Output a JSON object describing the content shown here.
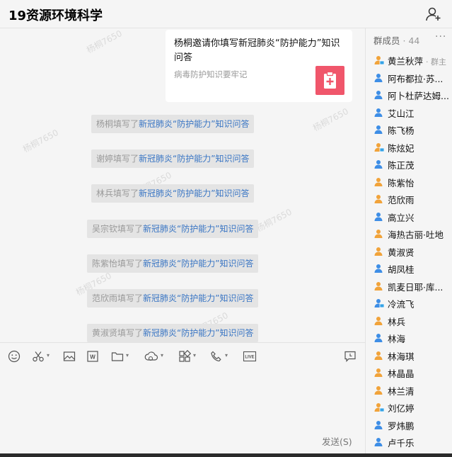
{
  "header": {
    "title": "19资源环境科学",
    "add_member_icon": "add-person-icon"
  },
  "watermark_text": "杨桐7650",
  "card": {
    "title": "杨桐邀请你填写新冠肺炎“防护能力”知识问答",
    "subtitle": "病毒防护知识要牢记",
    "icon": "medical-kit-icon",
    "icon_color": "#f0566b"
  },
  "system_messages": [
    {
      "name": "杨桐",
      "verb": "填写了",
      "link": "新冠肺炎“防护能力”知识问答"
    },
    {
      "name": "谢婷",
      "verb": "填写了",
      "link": "新冠肺炎“防护能力”知识问答"
    },
    {
      "name": "林兵",
      "verb": "填写了",
      "link": "新冠肺炎“防护能力”知识问答"
    },
    {
      "name": "吴宗钦",
      "verb": "填写了",
      "link": "新冠肺炎“防护能力”知识问答"
    },
    {
      "name": "陈紫怡",
      "verb": "填写了",
      "link": "新冠肺炎“防护能力”知识问答"
    },
    {
      "name": "范欣雨",
      "verb": "填写了",
      "link": "新冠肺炎“防护能力”知识问答"
    },
    {
      "name": "黄淑贤",
      "verb": "填写了",
      "link": "新冠肺炎“防护能力”知识问答"
    }
  ],
  "toolbar": {
    "icons": [
      "emoji-icon",
      "scissors-icon",
      "image-icon",
      "word-doc-icon",
      "folder-icon",
      "cloud-icon",
      "apps-icon",
      "phone-icon",
      "live-icon",
      "chat-history-icon"
    ],
    "live_label": "LIVE"
  },
  "composer": {
    "send_label": "发送(S)"
  },
  "members": {
    "label": "群成员",
    "separator": " · ",
    "count": "44",
    "more": "···",
    "owner_role": "· 群主",
    "colors": {
      "blue": "#3e8ee6",
      "orange": "#f1a33a",
      "badge": "#36a3e6"
    },
    "list": [
      {
        "name": "黄兰秋萍",
        "color": "orange",
        "badge": true,
        "owner": true
      },
      {
        "name": "阿布都拉·苏...",
        "color": "blue",
        "badge": false
      },
      {
        "name": "阿卜杜萨达姆...",
        "color": "blue",
        "badge": false
      },
      {
        "name": "艾山江",
        "color": "blue",
        "badge": false
      },
      {
        "name": "陈飞杨",
        "color": "blue",
        "badge": false
      },
      {
        "name": "陈炫妃",
        "color": "orange",
        "badge": true
      },
      {
        "name": "陈正茂",
        "color": "blue",
        "badge": false
      },
      {
        "name": "陈紫怡",
        "color": "orange",
        "badge": false
      },
      {
        "name": "范欣雨",
        "color": "orange",
        "badge": false
      },
      {
        "name": "高立兴",
        "color": "blue",
        "badge": false
      },
      {
        "name": "海热古丽·吐地",
        "color": "orange",
        "badge": false
      },
      {
        "name": "黄淑贤",
        "color": "orange",
        "badge": false
      },
      {
        "name": "胡凤桂",
        "color": "blue",
        "badge": false
      },
      {
        "name": "凯麦日耶·库...",
        "color": "orange",
        "badge": false
      },
      {
        "name": "冷流飞",
        "color": "blue",
        "badge": true
      },
      {
        "name": "林兵",
        "color": "orange",
        "badge": false
      },
      {
        "name": "林海",
        "color": "blue",
        "badge": false
      },
      {
        "name": "林海琪",
        "color": "orange",
        "badge": false
      },
      {
        "name": "林晶晶",
        "color": "orange",
        "badge": false
      },
      {
        "name": "林兰清",
        "color": "orange",
        "badge": false
      },
      {
        "name": "刘亿婷",
        "color": "orange",
        "badge": true
      },
      {
        "name": "罗炜鹏",
        "color": "blue",
        "badge": false
      },
      {
        "name": "卢千乐",
        "color": "blue",
        "badge": false
      }
    ]
  }
}
